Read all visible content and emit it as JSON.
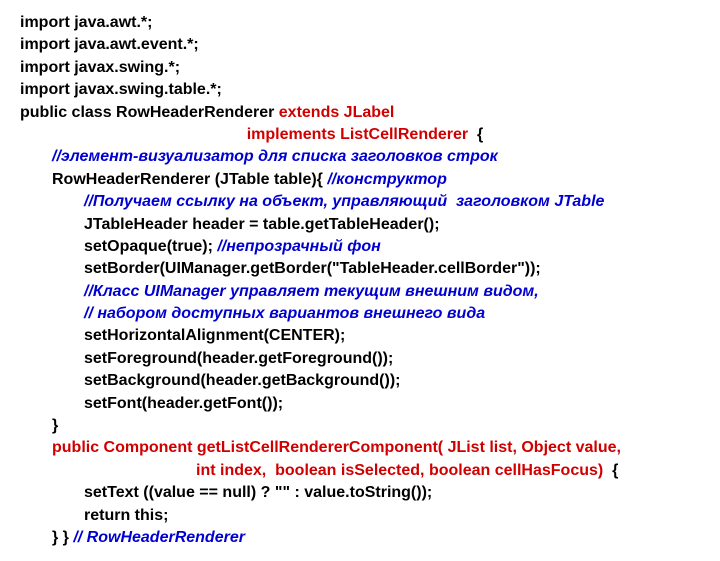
{
  "lines": [
    {
      "cls": "line bold",
      "spans": [
        {
          "t": "import java.awt.*;",
          "c": "black"
        }
      ]
    },
    {
      "cls": "line bold",
      "spans": [
        {
          "t": "import java.awt.event.*;",
          "c": "black"
        }
      ]
    },
    {
      "cls": "line bold",
      "spans": [
        {
          "t": "import javax.swing.*;",
          "c": "black"
        }
      ]
    },
    {
      "cls": "line bold",
      "spans": [
        {
          "t": "import javax.swing.table.*;",
          "c": "black"
        }
      ]
    },
    {
      "cls": "line bold",
      "spans": [
        {
          "t": "public class RowHeaderRenderer ",
          "c": "black"
        },
        {
          "t": "extends JLabel",
          "c": "red"
        }
      ]
    },
    {
      "cls": "line bold",
      "spans": [
        {
          "t": "                                                   ",
          "c": "black"
        },
        {
          "t": "implements ListCellRenderer",
          "c": "red"
        },
        {
          "t": "  {",
          "c": "black"
        }
      ]
    },
    {
      "cls": "line i1 bold italic",
      "spans": [
        {
          "t": "//элемент-визуализатор для списка заголовков строк",
          "c": "blue"
        }
      ]
    },
    {
      "cls": "line i1 bold",
      "spans": [
        {
          "t": "RowHeaderRenderer (JTable table){ ",
          "c": "black"
        },
        {
          "t": "//конструктор",
          "c": "blue italic"
        }
      ]
    },
    {
      "cls": "line i2 bold italic",
      "spans": [
        {
          "t": "//Получаем ссылку на объект, управляющий  заголовком JTable",
          "c": "blue"
        }
      ]
    },
    {
      "cls": "line i2 bold",
      "spans": [
        {
          "t": "JTableHeader header = table.getTableHeader();",
          "c": "black"
        }
      ]
    },
    {
      "cls": "line i2 bold",
      "spans": [
        {
          "t": "setOpaque(true); ",
          "c": "black"
        },
        {
          "t": "//непрозрачный фон",
          "c": "blue italic"
        }
      ]
    },
    {
      "cls": "line i2 bold",
      "spans": [
        {
          "t": "setBorder(UIManager.getBorder(\"TableHeader.cellBorder\"));",
          "c": "black"
        }
      ]
    },
    {
      "cls": "line i2 bold italic",
      "spans": [
        {
          "t": "//Класс UIManager управляет текущим внешним видом,",
          "c": "blue"
        }
      ]
    },
    {
      "cls": "line i2 bold italic",
      "spans": [
        {
          "t": "// набором доступных вариантов внешнего вида",
          "c": "blue"
        }
      ]
    },
    {
      "cls": "line i2 bold",
      "spans": [
        {
          "t": "setHorizontalAlignment(CENTER);",
          "c": "black"
        }
      ]
    },
    {
      "cls": "line i2 bold",
      "spans": [
        {
          "t": "setForeground(header.getForeground());",
          "c": "black"
        }
      ]
    },
    {
      "cls": "line i2 bold",
      "spans": [
        {
          "t": "setBackground(header.getBackground());",
          "c": "black"
        }
      ]
    },
    {
      "cls": "line i2 bold",
      "spans": [
        {
          "t": "setFont(header.getFont());",
          "c": "black"
        }
      ]
    },
    {
      "cls": "line i1 bold",
      "spans": [
        {
          "t": "}",
          "c": "black"
        }
      ]
    },
    {
      "cls": "line i1 bold",
      "spans": [
        {
          "t": "public Component getListCellRendererComponent( JList list, Object value,",
          "c": "red"
        }
      ]
    },
    {
      "cls": "line i3 bold",
      "spans": [
        {
          "t": "int index,  boolean isSelected, boolean cellHasFocus)",
          "c": "red"
        },
        {
          "t": "  {",
          "c": "black"
        }
      ]
    },
    {
      "cls": "line i2 bold",
      "spans": [
        {
          "t": "setText ((value == null) ? \"\" : value.toString());",
          "c": "black"
        }
      ]
    },
    {
      "cls": "line i2 bold",
      "spans": [
        {
          "t": "return this;",
          "c": "black"
        }
      ]
    },
    {
      "cls": "line i1 bold",
      "spans": [
        {
          "t": "} } ",
          "c": "black"
        },
        {
          "t": "// RowHeaderRenderer",
          "c": "blue italic"
        }
      ]
    }
  ]
}
